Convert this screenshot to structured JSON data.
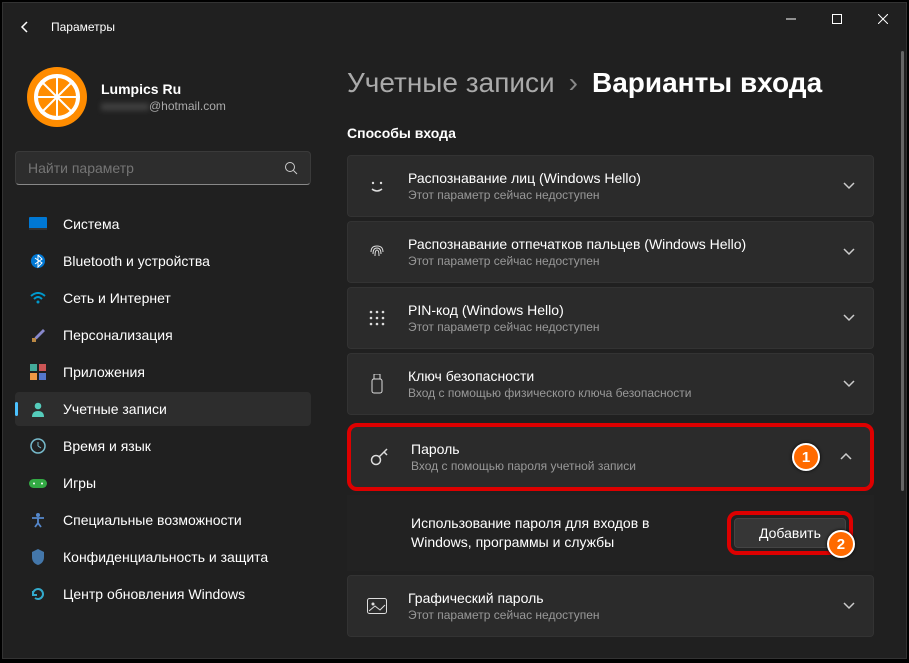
{
  "window": {
    "title": "Параметры"
  },
  "user": {
    "name": "Lumpics Ru",
    "email_suffix": "@hotmail.com"
  },
  "search": {
    "placeholder": "Найти параметр"
  },
  "nav": [
    {
      "label": "Система"
    },
    {
      "label": "Bluetooth и устройства"
    },
    {
      "label": "Сеть и Интернет"
    },
    {
      "label": "Персонализация"
    },
    {
      "label": "Приложения"
    },
    {
      "label": "Учетные записи"
    },
    {
      "label": "Время и язык"
    },
    {
      "label": "Игры"
    },
    {
      "label": "Специальные возможности"
    },
    {
      "label": "Конфиденциальность и защита"
    },
    {
      "label": "Центр обновления Windows"
    }
  ],
  "breadcrumb": {
    "root": "Учетные записи",
    "current": "Варианты входа"
  },
  "section": "Способы входа",
  "options": [
    {
      "title": "Распознавание лиц (Windows Hello)",
      "sub": "Этот параметр сейчас недоступен"
    },
    {
      "title": "Распознавание отпечатков пальцев (Windows Hello)",
      "sub": "Этот параметр сейчас недоступен"
    },
    {
      "title": "PIN-код (Windows Hello)",
      "sub": "Этот параметр сейчас недоступен"
    },
    {
      "title": "Ключ безопасности",
      "sub": "Вход с помощью физического ключа безопасности"
    },
    {
      "title": "Пароль",
      "sub": "Вход с помощью пароля учетной записи"
    },
    {
      "title": "Графический пароль",
      "sub": "Этот параметр сейчас недоступен"
    }
  ],
  "password_sub": {
    "text": "Использование пароля для входов в Windows, программы и службы",
    "button": "Добавить"
  },
  "callouts": {
    "one": "1",
    "two": "2"
  }
}
